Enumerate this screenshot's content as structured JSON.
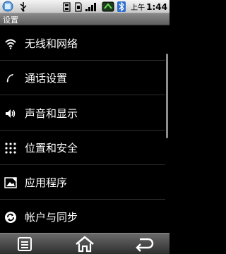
{
  "status_bar": {
    "icons": [
      "signal-strength-icon",
      "usb-icon",
      "battery-warning-icon",
      "sim-icon",
      "network-signal-icon",
      "data-traffic-icon",
      "bluetooth-icon"
    ],
    "time_ampm": "上午",
    "time": "1:44"
  },
  "title": "设置",
  "settings_items": [
    {
      "label": "无线和网络",
      "icon": "wifi-icon"
    },
    {
      "label": "通话设置",
      "icon": "phone-icon"
    },
    {
      "label": "声音和显示",
      "icon": "speaker-icon"
    },
    {
      "label": "位置和安全",
      "icon": "grid-lock-icon"
    },
    {
      "label": "应用程序",
      "icon": "app-icon"
    },
    {
      "label": "帐户与同步",
      "icon": "sync-icon"
    }
  ],
  "nav_bar": {
    "buttons": [
      "menu-icon",
      "home-icon",
      "back-icon"
    ]
  },
  "colors": {
    "background": "#000000",
    "status_bar": "#e0e0e0",
    "title_bar": "#707070",
    "divider": "#2e2e2e",
    "nav_bar": "#3c3c3c"
  }
}
